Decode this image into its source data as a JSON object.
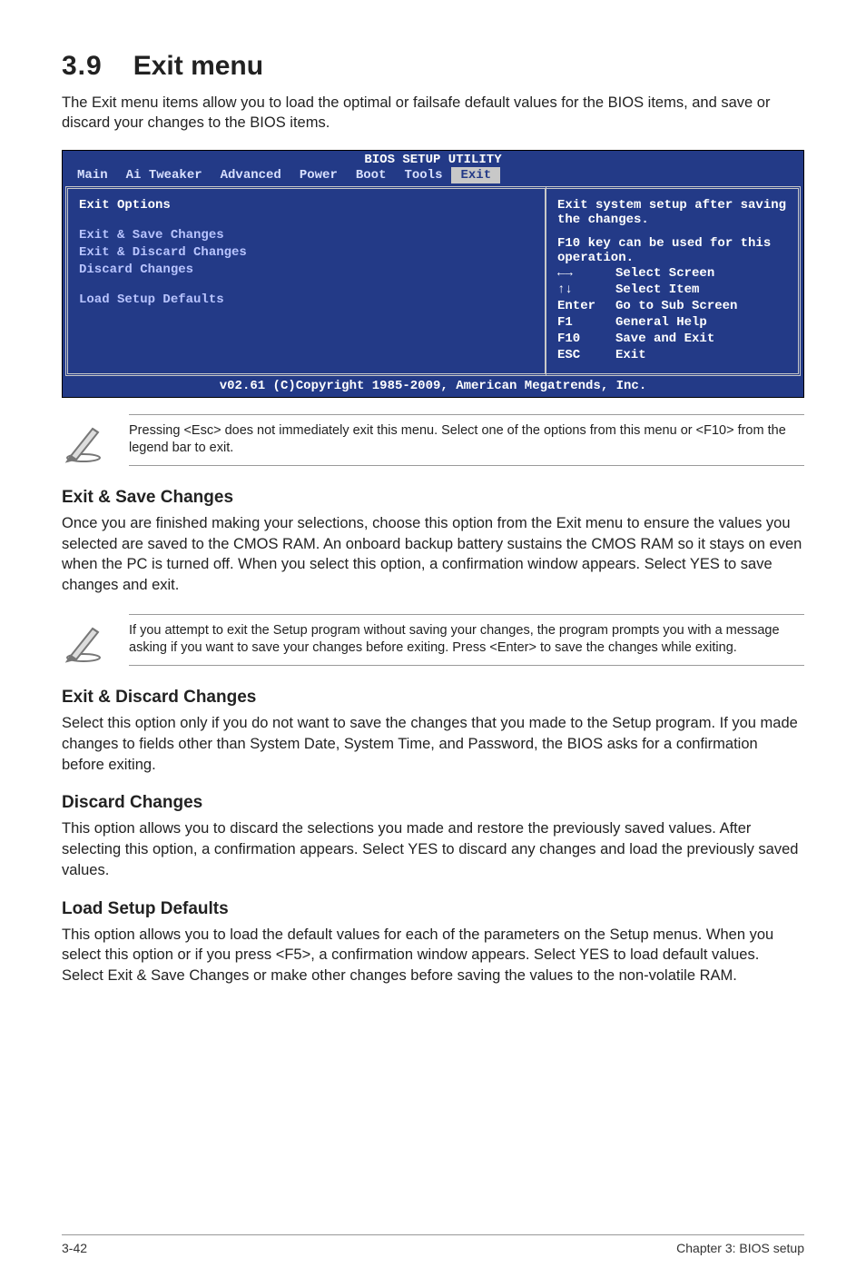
{
  "heading": {
    "number": "3.9",
    "title": "Exit menu"
  },
  "intro": "The Exit menu items allow you to load the optimal or failsafe default values for the BIOS items, and save or discard your changes to the BIOS items.",
  "bios": {
    "title": "BIOS SETUP UTILITY",
    "tabs": [
      "Main",
      "Ai Tweaker",
      "Advanced",
      "Power",
      "Boot",
      "Tools",
      "Exit"
    ],
    "left": {
      "header": "Exit Options",
      "items": [
        "Exit & Save Changes",
        "Exit & Discard Changes",
        "Discard Changes"
      ],
      "items2": [
        "Load Setup Defaults"
      ]
    },
    "help": {
      "line1": "Exit system setup after saving the changes.",
      "line2": "F10 key can be used for this operation."
    },
    "nav": [
      {
        "key": "←→",
        "label": "Select Screen"
      },
      {
        "key": "↑↓",
        "label": "Select Item"
      },
      {
        "key": "Enter",
        "label": "Go to Sub Screen"
      },
      {
        "key": "F1",
        "label": "General Help"
      },
      {
        "key": "F10",
        "label": "Save and Exit"
      },
      {
        "key": "ESC",
        "label": "Exit"
      }
    ],
    "footer": "v02.61 (C)Copyright 1985-2009, American Megatrends, Inc."
  },
  "note1": "Pressing <Esc> does not immediately exit this menu. Select one of the options from this menu or <F10> from the legend bar to exit.",
  "sections": {
    "s1": {
      "title": "Exit & Save Changes",
      "body": "Once you are finished making your selections, choose this option from the Exit menu to ensure the values you selected are saved to the CMOS RAM. An onboard backup battery sustains the CMOS RAM so it stays on even when the PC is turned off. When you select this option, a confirmation window appears. Select YES to save changes and exit."
    },
    "s2": {
      "title": "Exit & Discard Changes",
      "body": "Select this option only if you do not want to save the changes that you  made to the Setup program. If you made changes to fields other than System Date, System Time, and Password, the BIOS asks for a confirmation before exiting."
    },
    "s3": {
      "title": "Discard Changes",
      "body": "This option allows you to discard the selections you made and restore the previously saved values. After selecting this option, a confirmation appears. Select YES to discard any changes and load the previously saved values."
    },
    "s4": {
      "title": "Load Setup Defaults",
      "body": "This option allows you to load the default values for each of the parameters on the Setup menus. When you select this option or if you press <F5>, a confirmation window appears. Select YES to load default values. Select Exit & Save Changes or make other changes before saving the values to the non-volatile RAM."
    }
  },
  "note2": " If you attempt to exit the Setup program without saving your changes, the program prompts you with a message asking if you want to save your changes before exiting. Press <Enter>  to save the changes while exiting.",
  "footer": {
    "left": "3-42",
    "right": "Chapter 3: BIOS setup"
  }
}
